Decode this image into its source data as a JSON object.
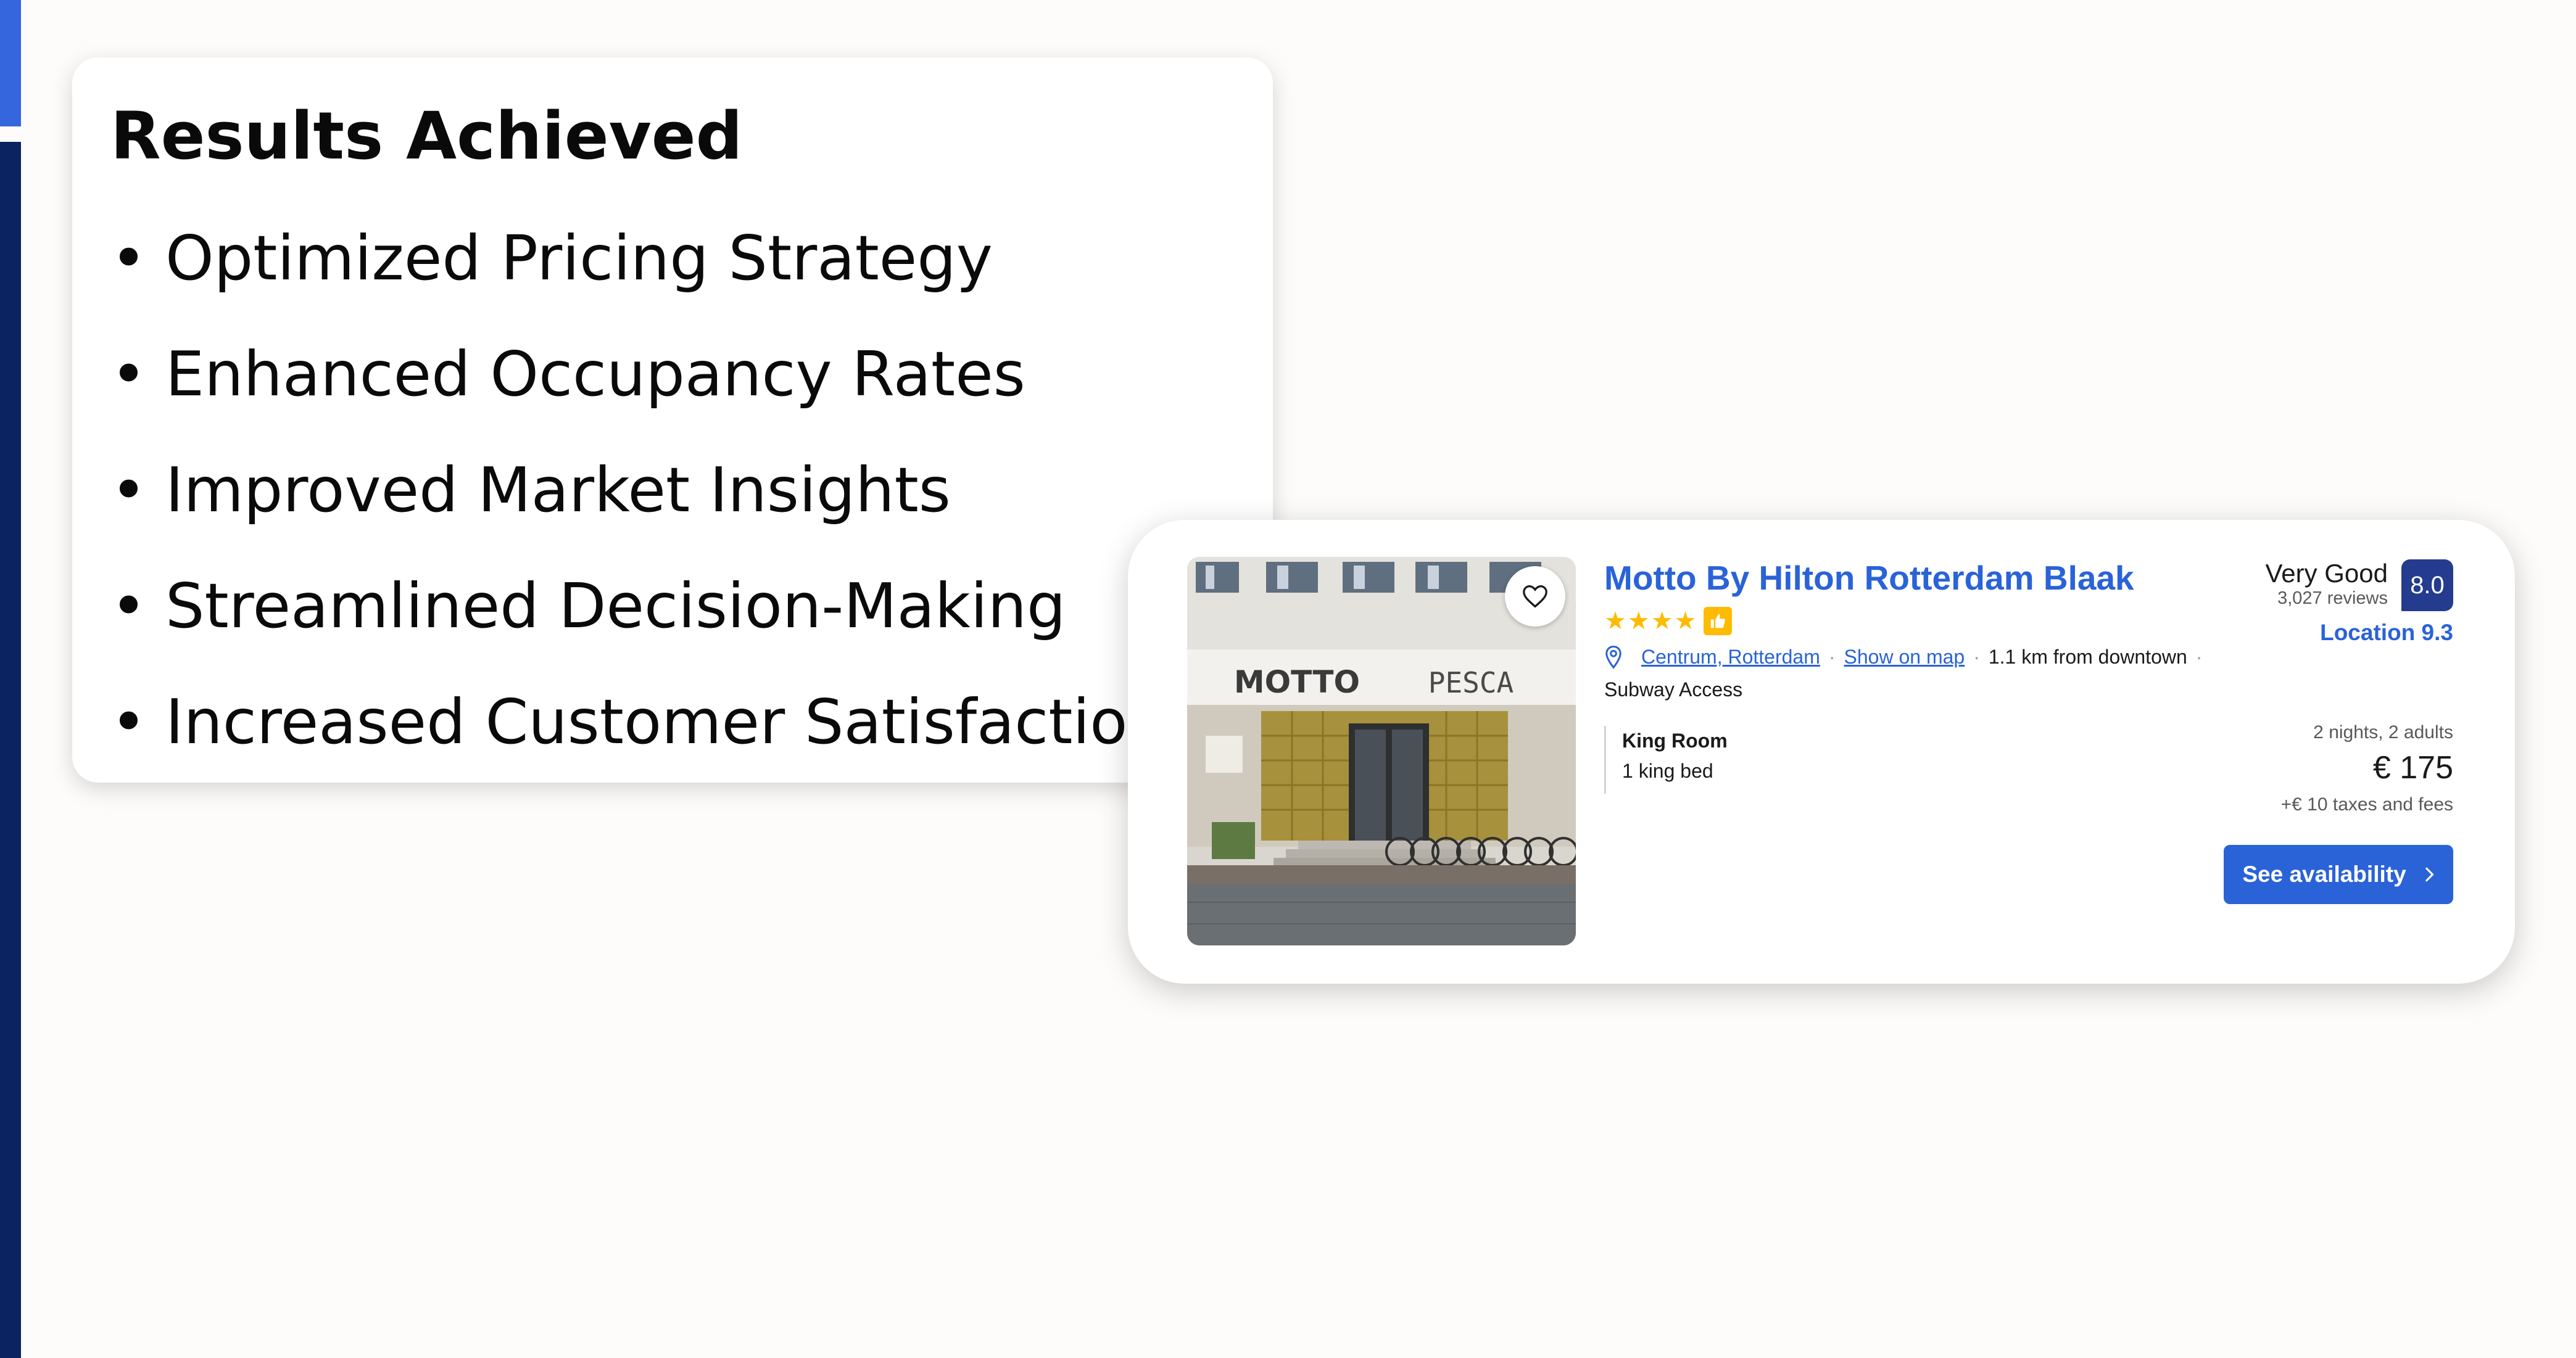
{
  "colors": {
    "sidebar_dark": "#0b2360",
    "sidebar_accent": "#3666dd",
    "link_blue": "#2a63d8",
    "score_badge": "#243b8e",
    "star_yellow": "#febb02"
  },
  "results": {
    "title": "Results Achieved",
    "bullet": "•",
    "items": [
      "Optimized Pricing Strategy",
      "Enhanced Occupancy Rates",
      "Improved Market Insights",
      "Streamlined Decision-Making",
      "Increased Customer Satisfaction"
    ]
  },
  "hotel": {
    "photo_sign_left": "MOTTO",
    "photo_sign_right": "PESCA",
    "favorite_icon": "heart-outline-icon",
    "name": "Motto By Hilton Rotterdam Blaak",
    "stars": 4,
    "star_glyph": "★",
    "preferred_icon": "thumbs-up-icon",
    "location_icon": "map-pin-icon",
    "area_link": "Centrum, Rotterdam",
    "map_link": "Show on map",
    "distance": "1.1 km from downtown",
    "separator": "·",
    "subway": "Subway Access",
    "room_name": "King Room",
    "room_bed": "1 king bed",
    "review_label": "Very Good",
    "review_count": "3,027 reviews",
    "score": "8.0",
    "location_score": "Location 9.3",
    "stay": "2 nights, 2 adults",
    "price": "€ 175",
    "taxes": "+€ 10 taxes and fees",
    "cta": "See availability",
    "cta_icon": "chevron-right-icon"
  }
}
